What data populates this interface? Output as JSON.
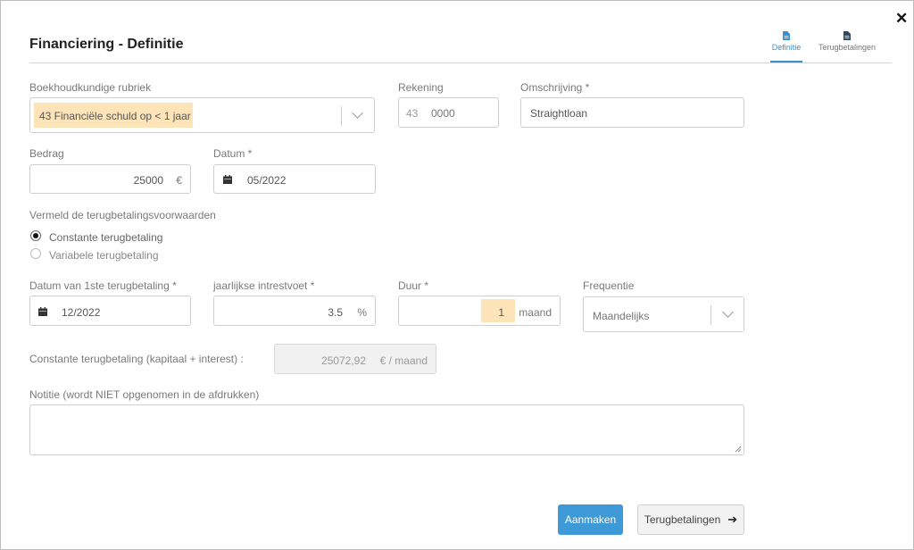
{
  "dialog": {
    "title": "Financiering - Definitie",
    "close_glyph": "✕"
  },
  "tabs": [
    {
      "label": "Definitie",
      "icon": "document-icon",
      "active": true
    },
    {
      "label": "Terugbetalingen",
      "icon": "document-icon",
      "active": false
    }
  ],
  "fields": {
    "rubriek": {
      "label": "Boekhoudkundige rubriek",
      "value": "43 Financiële schuld op < 1 jaar"
    },
    "rekening": {
      "label": "Rekening",
      "prefix": "43",
      "value": "0000"
    },
    "omschrijving": {
      "label": "Omschrijving *",
      "value": "Straightloan"
    },
    "bedrag": {
      "label": "Bedrag",
      "value": "25000",
      "unit": "€"
    },
    "datum": {
      "label": "Datum *",
      "value": "05/2022"
    },
    "voorwaarden": {
      "label": "Vermeld de terugbetalingsvoorwaarden",
      "options": [
        {
          "label": "Constante terugbetaling",
          "selected": true
        },
        {
          "label": "Variabele terugbetaling",
          "selected": false
        }
      ]
    },
    "eerste_terugbetaling": {
      "label": "Datum van 1ste terugbetaling *",
      "value": "12/2022"
    },
    "intrestvoet": {
      "label": "jaarlijkse intrestvoet *",
      "value": "3.5",
      "unit": "%"
    },
    "duur": {
      "label": "Duur *",
      "value": "1",
      "unit": "maand"
    },
    "frequentie": {
      "label": "Frequentie",
      "value": "Maandelijks"
    },
    "constante": {
      "label": "Constante terugbetaling (kapitaal + interest) :",
      "value": "25072,92",
      "unit": "€ / maand"
    },
    "notitie": {
      "label": "Notitie (wordt NIET opgenomen in de afdrukken)",
      "value": ""
    }
  },
  "buttons": {
    "create": "Aanmaken",
    "next": "Terugbetalingen",
    "next_arrow": "➔"
  },
  "colors": {
    "accent": "#3d9ad6",
    "highlight": "#fde4b8"
  }
}
